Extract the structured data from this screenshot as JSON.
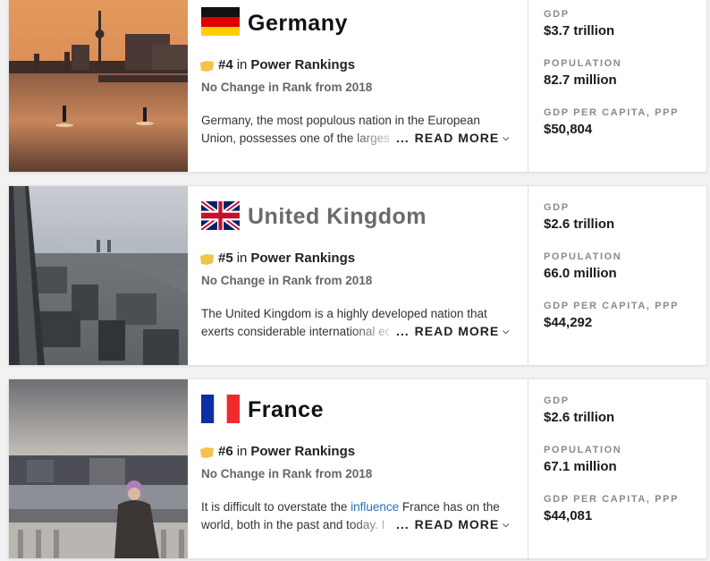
{
  "countries": [
    {
      "name": "Germany",
      "rank": "#4",
      "rank_in": "in",
      "rankings_label": "Power Rankings",
      "change": "No Change in Rank from 2018",
      "desc_line1": "Germany, the most populous nation in the European",
      "desc_line2_pre": "Union, possesses one of the largest",
      "desc_link": "",
      "desc_line2_post": "",
      "read_more": "READ MORE",
      "read_dots": "...",
      "stats": [
        {
          "label": "GDP",
          "value": "$3.7 trillion"
        },
        {
          "label": "POPULATION",
          "value": "82.7 million"
        },
        {
          "label": "GDP PER CAPITA, PPP",
          "value": "$50,804"
        }
      ]
    },
    {
      "name": "United Kingdom",
      "rank": "#5",
      "rank_in": "in",
      "rankings_label": "Power Rankings",
      "change": "No Change in Rank from 2018",
      "desc_line1": "The United Kingdom is a highly developed nation that",
      "desc_line2_pre": "exerts considerable international eco",
      "desc_link": "",
      "desc_line2_post": "",
      "read_more": "READ MORE",
      "read_dots": "...",
      "stats": [
        {
          "label": "GDP",
          "value": "$2.6 trillion"
        },
        {
          "label": "POPULATION",
          "value": "66.0 million"
        },
        {
          "label": "GDP PER CAPITA, PPP",
          "value": "$44,292"
        }
      ]
    },
    {
      "name": "France",
      "rank": "#6",
      "rank_in": "in",
      "rankings_label": "Power Rankings",
      "change": "No Change in Rank from 2018",
      "desc_line1_pre": "It is difficult to overstate the ",
      "desc_link": "influence",
      "desc_line1_post": " France has on the",
      "desc_line2_pre": "world, both in the past and today. I",
      "read_more": "READ MORE",
      "read_dots": "...",
      "stats": [
        {
          "label": "GDP",
          "value": "$2.6 trillion"
        },
        {
          "label": "POPULATION",
          "value": "67.1 million"
        },
        {
          "label": "GDP PER CAPITA, PPP",
          "value": "$44,081"
        }
      ]
    }
  ],
  "colors": {
    "link": "#2a6db5",
    "medal": "#f2c24b",
    "label_grey": "#8a8a8a"
  },
  "icons": [
    "flag-germany-icon",
    "flag-uk-icon",
    "flag-france-icon",
    "medal-icon",
    "chevron-down-icon"
  ]
}
